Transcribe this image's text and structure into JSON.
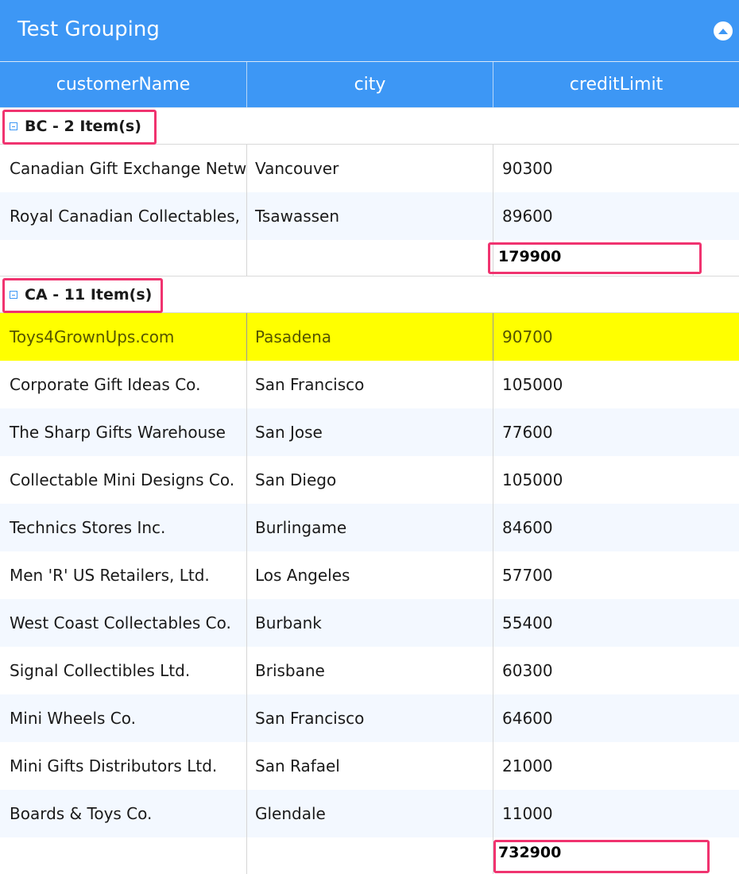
{
  "panel": {
    "title": "Test Grouping",
    "collapse_icon": "collapse-up-icon"
  },
  "columns": [
    "customerName",
    "city",
    "creditLimit"
  ],
  "groups": [
    {
      "label": "BC - 2 Item(s)",
      "rows": [
        {
          "customerName": "Canadian Gift Exchange Network",
          "city": "Vancouver",
          "creditLimit": "90300"
        },
        {
          "customerName": "Royal Canadian Collectables, Ltd.",
          "city": "Tsawassen",
          "creditLimit": "89600"
        }
      ],
      "total": "179900"
    },
    {
      "label": "CA - 11 Item(s)",
      "rows": [
        {
          "customerName": "Toys4GrownUps.com",
          "city": "Pasadena",
          "creditLimit": "90700"
        },
        {
          "customerName": "Corporate Gift Ideas Co.",
          "city": "San Francisco",
          "creditLimit": "105000"
        },
        {
          "customerName": "The Sharp Gifts Warehouse",
          "city": "San Jose",
          "creditLimit": "77600"
        },
        {
          "customerName": "Collectable Mini Designs Co.",
          "city": "San Diego",
          "creditLimit": "105000"
        },
        {
          "customerName": "Technics Stores Inc.",
          "city": "Burlingame",
          "creditLimit": "84600"
        },
        {
          "customerName": "Men 'R' US Retailers, Ltd.",
          "city": "Los Angeles",
          "creditLimit": "57700"
        },
        {
          "customerName": "West Coast Collectables Co.",
          "city": "Burbank",
          "creditLimit": "55400"
        },
        {
          "customerName": "Signal Collectibles Ltd.",
          "city": "Brisbane",
          "creditLimit": "60300"
        },
        {
          "customerName": "Mini Wheels Co.",
          "city": "San Francisco",
          "creditLimit": "64600"
        },
        {
          "customerName": "Mini Gifts Distributors Ltd.",
          "city": "San Rafael",
          "creditLimit": "21000"
        },
        {
          "customerName": "Boards & Toys Co.",
          "city": "Glendale",
          "creditLimit": "11000"
        }
      ],
      "total": "732900"
    }
  ],
  "colors": {
    "header_bg": "#3d97f5",
    "highlight_row": "#ffff00",
    "annotation_box": "#f0336f",
    "alt_row": "#f3f8ff"
  }
}
